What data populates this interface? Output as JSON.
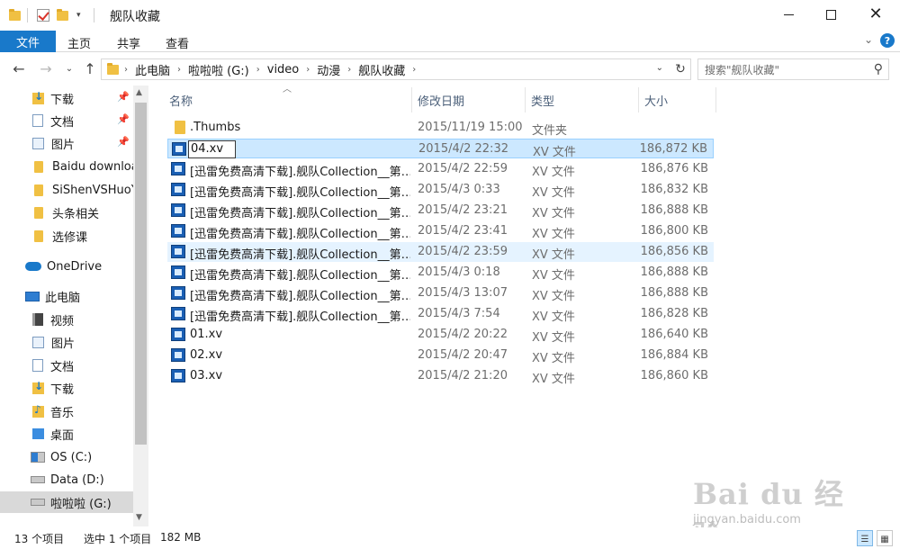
{
  "window": {
    "title": "舰队收藏",
    "quick_access_dropdown": "▾"
  },
  "ribbon": {
    "tabs": [
      "文件",
      "主页",
      "共享",
      "查看"
    ]
  },
  "address": {
    "crumbs": [
      "此电脑",
      "啦啦啦 (G:)",
      "video",
      "动漫",
      "舰队收藏"
    ],
    "search_placeholder": "搜索\"舰队收藏\""
  },
  "sidebar": {
    "quick_access": [
      {
        "label": "下载",
        "icon": "download-folder-icon",
        "pinned": true
      },
      {
        "label": "文档",
        "icon": "documents-icon",
        "pinned": true
      },
      {
        "label": "图片",
        "icon": "pictures-icon",
        "pinned": true
      },
      {
        "label": "Baidu download",
        "icon": "folder-icon",
        "pinned": false
      },
      {
        "label": "SiShenVSHuoY",
        "icon": "folder-icon",
        "pinned": false
      },
      {
        "label": "头条相关",
        "icon": "folder-icon",
        "pinned": false
      },
      {
        "label": "选修课",
        "icon": "folder-icon",
        "pinned": false
      }
    ],
    "onedrive": "OneDrive",
    "this_pc": "此电脑",
    "pc_items": [
      {
        "label": "视频",
        "icon": "videos-icon"
      },
      {
        "label": "图片",
        "icon": "pictures-icon"
      },
      {
        "label": "文档",
        "icon": "documents-icon"
      },
      {
        "label": "下载",
        "icon": "download-folder-icon"
      },
      {
        "label": "音乐",
        "icon": "music-icon"
      },
      {
        "label": "桌面",
        "icon": "desktop-icon"
      },
      {
        "label": "OS (C:)",
        "icon": "os-drive-icon"
      },
      {
        "label": "Data (D:)",
        "icon": "drive-icon"
      },
      {
        "label": "啦啦啦 (G:)",
        "icon": "drive-icon"
      }
    ]
  },
  "columns": {
    "name": "名称",
    "date": "修改日期",
    "type": "类型",
    "size": "大小"
  },
  "files": [
    {
      "name": ".Thumbs",
      "date": "2015/11/19 15:00",
      "type": "文件夹",
      "size": "",
      "kind": "folder"
    },
    {
      "name": "04.xv",
      "date": "2015/4/2 22:32",
      "type": "XV 文件",
      "size": "186,872 KB",
      "kind": "xv",
      "state": "renaming"
    },
    {
      "name": "[迅雷免费高清下载].舰队Collection__第…",
      "date": "2015/4/2 22:59",
      "type": "XV 文件",
      "size": "186,876 KB",
      "kind": "xv"
    },
    {
      "name": "[迅雷免费高清下载].舰队Collection__第…",
      "date": "2015/4/3 0:33",
      "type": "XV 文件",
      "size": "186,832 KB",
      "kind": "xv"
    },
    {
      "name": "[迅雷免费高清下载].舰队Collection__第…",
      "date": "2015/4/2 23:21",
      "type": "XV 文件",
      "size": "186,888 KB",
      "kind": "xv"
    },
    {
      "name": "[迅雷免费高清下载].舰队Collection__第…",
      "date": "2015/4/2 23:41",
      "type": "XV 文件",
      "size": "186,800 KB",
      "kind": "xv"
    },
    {
      "name": "[迅雷免费高清下载].舰队Collection__第…",
      "date": "2015/4/2 23:59",
      "type": "XV 文件",
      "size": "186,856 KB",
      "kind": "xv",
      "state": "hover"
    },
    {
      "name": "[迅雷免费高清下载].舰队Collection__第…",
      "date": "2015/4/3 0:18",
      "type": "XV 文件",
      "size": "186,888 KB",
      "kind": "xv"
    },
    {
      "name": "[迅雷免费高清下载].舰队Collection__第…",
      "date": "2015/4/3 13:07",
      "type": "XV 文件",
      "size": "186,888 KB",
      "kind": "xv"
    },
    {
      "name": "[迅雷免费高清下载].舰队Collection__第…",
      "date": "2015/4/3 7:54",
      "type": "XV 文件",
      "size": "186,828 KB",
      "kind": "xv"
    },
    {
      "name": "01.xv",
      "date": "2015/4/2 20:22",
      "type": "XV 文件",
      "size": "186,640 KB",
      "kind": "xv"
    },
    {
      "name": "02.xv",
      "date": "2015/4/2 20:47",
      "type": "XV 文件",
      "size": "186,884 KB",
      "kind": "xv"
    },
    {
      "name": "03.xv",
      "date": "2015/4/2 21:20",
      "type": "XV 文件",
      "size": "186,860 KB",
      "kind": "xv"
    }
  ],
  "status": {
    "count": "13 个项目",
    "selected": "选中 1 个项目",
    "selected_size": "182 MB"
  },
  "watermark": {
    "logo": "Bai du 经验",
    "url": "jingyan.baidu.com"
  },
  "colors": {
    "accent": "#1979ca",
    "selection": "#cce8ff",
    "hover": "#e5f3ff"
  }
}
